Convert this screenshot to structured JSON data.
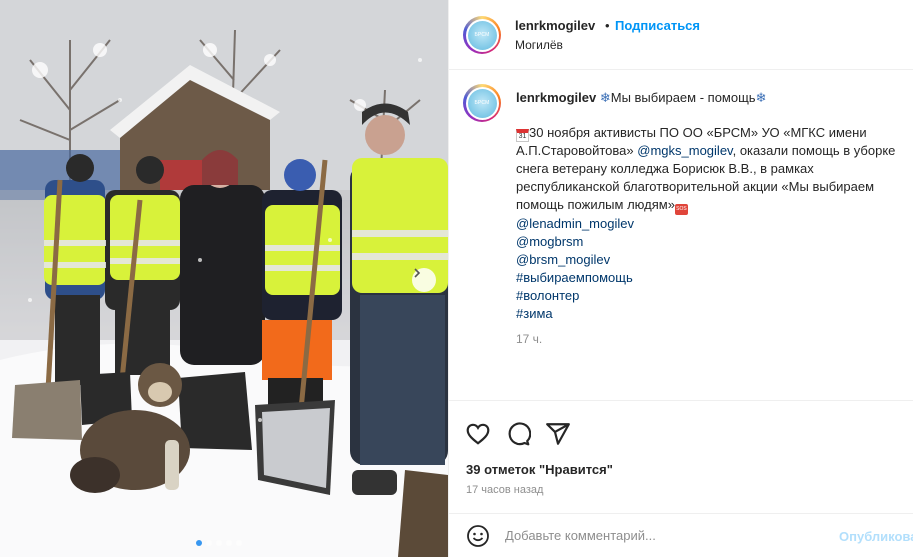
{
  "post": {
    "username": "lenrkmogilev",
    "separator": "•",
    "follow_label": "Подписаться",
    "location": "Могилёв",
    "avatar_text": "БРСМ"
  },
  "caption": {
    "username": "lenrkmogilev",
    "title": "Мы выбираем - помощь",
    "calendar_day": "31",
    "body": "30 ноября активисты ПО ОО «БРСМ» УО «МГКС имени А.П.Старовойтова»",
    "mention_inline": "@mgks_mogilev",
    "body_continued": ", оказали помощь в уборке снега ветерану колледжа Борисюк В.В., в рамках республиканской благотворительной акции «Мы выбираем помощь пожилым людям»",
    "sos_text": "SOS",
    "links": [
      "@lenadmin_mogilev",
      "@mogbrsm",
      "@brsm_mogilev",
      "#выбираемпомощь",
      "#волонтер",
      "#зима"
    ],
    "time": "17 ч."
  },
  "actions": {
    "likes": "39 отметок \"Нравится\"",
    "time_ago": "17 часов назад"
  },
  "comment": {
    "placeholder": "Добавьте комментарий...",
    "publish_label": "Опубликовать"
  },
  "carousel": {
    "slides": 5,
    "active_index": 0
  },
  "colors": {
    "accent": "#0095f6",
    "link": "#00376b",
    "muted": "#8e8e8e",
    "vest": "#d8f23a"
  },
  "icons": [
    "heart-icon",
    "comment-icon",
    "share-icon",
    "emoji-icon",
    "chevron-right-icon",
    "more-icon",
    "snowflake-icon",
    "calendar-icon",
    "sos-icon"
  ]
}
